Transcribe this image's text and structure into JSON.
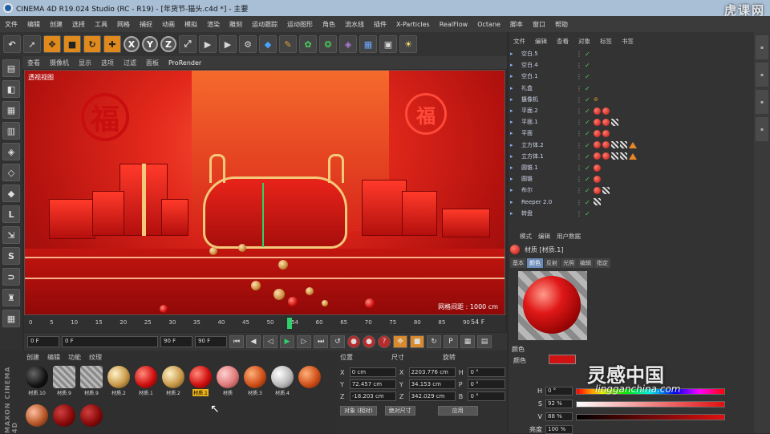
{
  "window": {
    "title": "CINEMA 4D R19.024 Studio (RC - R19) - [年货节-猫头.c4d *] - 主要",
    "watermark": "虎课网"
  },
  "menu": [
    "文件",
    "编辑",
    "创建",
    "选择",
    "工具",
    "网格",
    "捕捉",
    "动画",
    "模拟",
    "渲染",
    "雕刻",
    "运动跟踪",
    "运动图形",
    "角色",
    "流水线",
    "插件",
    "X-Particles",
    "RealFlow",
    "Octane",
    "脚本",
    "窗口",
    "帮助"
  ],
  "toolbar": {
    "x": "X",
    "y": "Y",
    "z": "Z"
  },
  "viewport": {
    "menu": [
      "查看",
      "摄像机",
      "显示",
      "选项",
      "过滤",
      "面板",
      "ProRender"
    ],
    "label": "透视视图",
    "grid": "网格间距 : 1000 cm",
    "scene_text_fu_left": "福",
    "scene_text_fu_right": "福"
  },
  "timeline": {
    "ticks": [
      "0",
      "5",
      "10",
      "15",
      "20",
      "25",
      "30",
      "35",
      "40",
      "45",
      "50",
      "54",
      "60",
      "65",
      "70",
      "75",
      "80",
      "85",
      "90"
    ],
    "current_frame": 54,
    "end_label": "54 F"
  },
  "transport": {
    "start": "0 F",
    "cur": "0 F",
    "mid": "90 F",
    "end": "90 F"
  },
  "material_manager": {
    "menu": [
      "创建",
      "编辑",
      "功能",
      "纹理"
    ],
    "brand": "MAXON CINEMA 4D",
    "materials": [
      {
        "name": "材质.10",
        "kind": "black",
        "selected": false
      },
      {
        "name": "材质.9",
        "kind": "hatch",
        "selected": false
      },
      {
        "name": "材质.9",
        "kind": "hatch",
        "selected": false
      },
      {
        "name": "材质.2",
        "kind": "gold",
        "selected": false
      },
      {
        "name": "材质.1",
        "kind": "red",
        "selected": false
      },
      {
        "name": "材质.2",
        "kind": "gold",
        "selected": false
      },
      {
        "name": "材质.1",
        "kind": "red",
        "selected": true
      },
      {
        "name": "材质",
        "kind": "pink",
        "selected": false
      },
      {
        "name": "材质.3",
        "kind": "orange",
        "selected": false
      },
      {
        "name": "材质.4",
        "kind": "white",
        "selected": false
      },
      {
        "name": "",
        "kind": "orange",
        "selected": false
      },
      {
        "name": "",
        "kind": "copper",
        "selected": false
      },
      {
        "name": "",
        "kind": "darkred",
        "selected": false
      },
      {
        "name": "",
        "kind": "darkred",
        "selected": false
      }
    ]
  },
  "coordinates": {
    "headers": [
      "位置",
      "尺寸",
      "旋转"
    ],
    "rows": [
      {
        "axis": "X",
        "pos": "0 cm",
        "size": "2203.776 cm",
        "rot_label": "H",
        "rot": "0 °"
      },
      {
        "axis": "Y",
        "pos": "72.457 cm",
        "size": "34.153 cm",
        "rot_label": "P",
        "rot": "0 °"
      },
      {
        "axis": "Z",
        "pos": "-18.203 cm",
        "size": "342.029 cm",
        "rot_label": "B",
        "rot": "0 °"
      }
    ],
    "mode": "对象 (相对)",
    "size_mode": "绝对尺寸",
    "apply": "应用"
  },
  "object_manager": {
    "menu": [
      "文件",
      "编辑",
      "查看",
      "对象",
      "标签",
      "书签"
    ],
    "objects": [
      {
        "name": "空白.5",
        "tags": []
      },
      {
        "name": "空白.4",
        "tags": []
      },
      {
        "name": "空白.1",
        "tags": []
      },
      {
        "name": "礼盒",
        "tags": []
      },
      {
        "name": "摄像机",
        "tags": [
          "target"
        ]
      },
      {
        "name": "平面.2",
        "tags": [
          "dot",
          "dot"
        ]
      },
      {
        "name": "平面.1",
        "tags": [
          "dot",
          "dot",
          "sq"
        ]
      },
      {
        "name": "平面",
        "tags": [
          "dot",
          "dot"
        ]
      },
      {
        "name": "立方体.2",
        "tags": [
          "dot",
          "dot",
          "sq",
          "sq",
          "tri"
        ]
      },
      {
        "name": "立方体.1",
        "tags": [
          "dot",
          "dot",
          "sq",
          "sq",
          "tri"
        ]
      },
      {
        "name": "圆锥.1",
        "tags": [
          "dot"
        ]
      },
      {
        "name": "圆锥",
        "tags": [
          "dot"
        ]
      },
      {
        "name": "布尔",
        "tags": [
          "dot",
          "sq"
        ]
      },
      {
        "name": "Reeper 2.0",
        "tags": [
          "sq"
        ]
      },
      {
        "name": "转盘",
        "tags": []
      }
    ]
  },
  "attributes": {
    "menu": [
      "模式",
      "编辑",
      "用户数据"
    ],
    "title": "材质 [材质.1]",
    "tabs": [
      "基本",
      "颜色",
      "反射",
      "光照",
      "编辑",
      "指定"
    ],
    "active_tab": "颜色",
    "section": "颜色",
    "color_label": "颜色",
    "H": {
      "label": "H",
      "value": "0 °"
    },
    "S": {
      "label": "S",
      "value": "92 %"
    },
    "V": {
      "label": "V",
      "value": "88 %"
    },
    "brightness": {
      "label": "亮度",
      "value": "100 %"
    },
    "swatch_color": "#d11212"
  },
  "watermark_bottom": {
    "cn": "灵感中国",
    "en": "lingganchina.com"
  }
}
